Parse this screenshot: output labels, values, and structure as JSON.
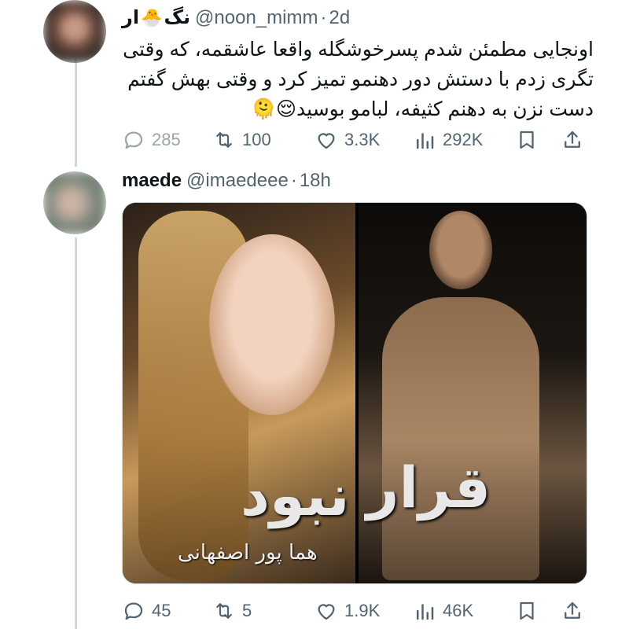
{
  "tweets": [
    {
      "name_part1": "نگ",
      "name_emoji": "🐣",
      "name_part2": "ار",
      "handle": "@noon_mimm",
      "separator": "·",
      "time": "2d",
      "text": "اونجایی مطمئن شدم پسرخوشگله واقعا عاشقمه، که وقتی تگری زدم با دستش دور دهنمو تمیز کرد و وقتی بهش گفتم دست نزن به دهنم کثیفه، لبامو بوسید😌🫠",
      "actions": {
        "replies": "285",
        "reposts": "100",
        "likes": "3.3K",
        "views": "292K"
      }
    },
    {
      "name": "maede",
      "handle": "@imaedeee",
      "separator": "·",
      "time": "18h",
      "media": {
        "title_left": "نبود",
        "title_right": "قرار",
        "author": "هما پور اصفهانی"
      },
      "actions": {
        "replies": "45",
        "reposts": "5",
        "likes": "1.9K",
        "views": "46K"
      }
    }
  ],
  "icons": [
    "reply-icon",
    "repost-icon",
    "like-icon",
    "views-icon",
    "bookmark-icon",
    "share-icon"
  ],
  "colors": {
    "text": "#0f1419",
    "secondary": "#536471",
    "thread_line": "#cfd9de"
  }
}
